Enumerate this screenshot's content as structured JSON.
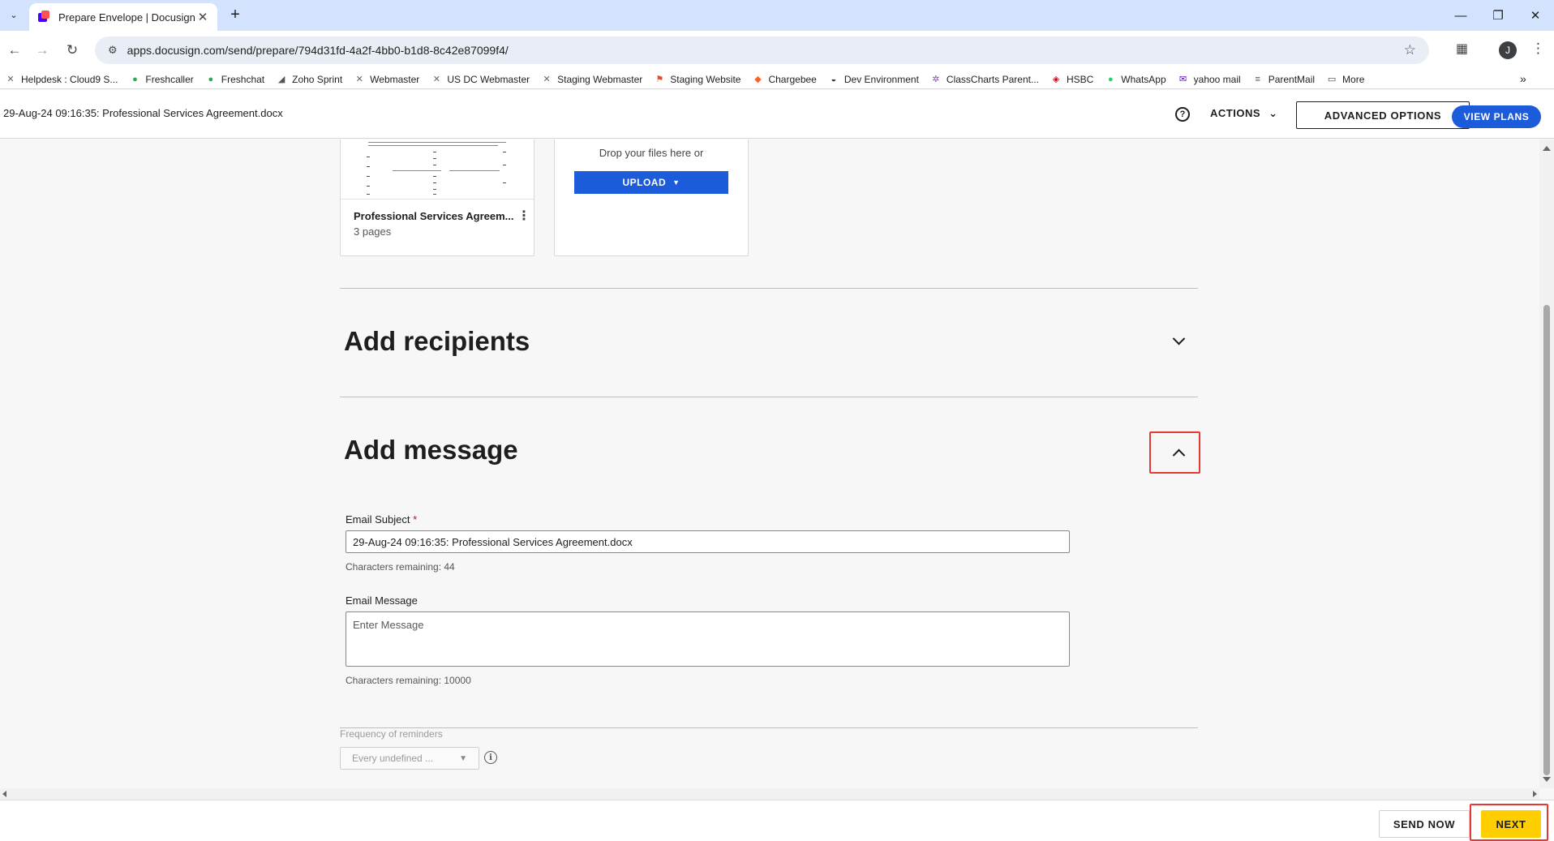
{
  "browser": {
    "tab_title": "Prepare Envelope | Docusign",
    "url": "apps.docusign.com/send/prepare/794d31fd-4a2f-4bb0-b1d8-8c42e87099f4/",
    "profile_initial": "J",
    "bookmarks": [
      {
        "label": "Helpdesk : Cloud9 S...",
        "icon": "crossed-tools-icon",
        "color": "#666666"
      },
      {
        "label": "Freshcaller",
        "icon": "phone-circle-icon",
        "color": "#2fa84f"
      },
      {
        "label": "Freshchat",
        "icon": "chat-bubble-icon",
        "color": "#2fa84f"
      },
      {
        "label": "Zoho Sprint",
        "icon": "sprint-icon",
        "color": "#555555"
      },
      {
        "label": "Webmaster",
        "icon": "crossed-tools-icon",
        "color": "#666666"
      },
      {
        "label": "US DC Webmaster",
        "icon": "crossed-tools-icon",
        "color": "#666666"
      },
      {
        "label": "Staging Webmaster",
        "icon": "crossed-tools-icon",
        "color": "#666666"
      },
      {
        "label": "Staging Website",
        "icon": "flag-icon",
        "color": "#e8491d"
      },
      {
        "label": "Chargebee",
        "icon": "chargebee-icon",
        "color": "#ff5e2b"
      },
      {
        "label": "Dev Environment",
        "icon": "speedometer-icon",
        "color": "#333333"
      },
      {
        "label": "ClassCharts Parent...",
        "icon": "star-burst-icon",
        "color": "#8e44ad"
      },
      {
        "label": "HSBC",
        "icon": "hsbc-icon",
        "color": "#db0011"
      },
      {
        "label": "WhatsApp",
        "icon": "whatsapp-icon",
        "color": "#25d366"
      },
      {
        "label": "yahoo mail",
        "icon": "mail-icon",
        "color": "#6001d2"
      },
      {
        "label": "ParentMail",
        "icon": "parentmail-icon",
        "color": "#555555"
      },
      {
        "label": "More",
        "icon": "folder-icon",
        "color": "#444444"
      }
    ]
  },
  "header": {
    "envelope_title": "29-Aug-24 09:16:35: Professional Services Agreement.docx",
    "actions_label": "ACTIONS",
    "advanced_label": "ADVANCED OPTIONS",
    "view_plans_label": "VIEW PLANS"
  },
  "documents": {
    "doc_name": "Professional Services Agreem...",
    "doc_pages": "3 pages",
    "drop_text": "Drop your files here or",
    "upload_label": "UPLOAD"
  },
  "sections": {
    "recipients_title": "Add recipients",
    "message_title": "Add message"
  },
  "message": {
    "subject_label": "Email Subject",
    "subject_required": "*",
    "subject_value": "29-Aug-24 09:16:35: Professional Services Agreement.docx",
    "subject_remaining": "Characters remaining: 44",
    "message_label": "Email Message",
    "message_placeholder": "Enter Message",
    "message_remaining": "Characters remaining: 10000"
  },
  "reminders": {
    "label": "Frequency of reminders",
    "selected": "Every undefined ..."
  },
  "footer": {
    "send_now_label": "SEND NOW",
    "next_label": "NEXT"
  },
  "colors": {
    "brand_blue": "#1c5cdb",
    "next_yellow": "#ffce00",
    "highlight_red": "#e53935"
  }
}
